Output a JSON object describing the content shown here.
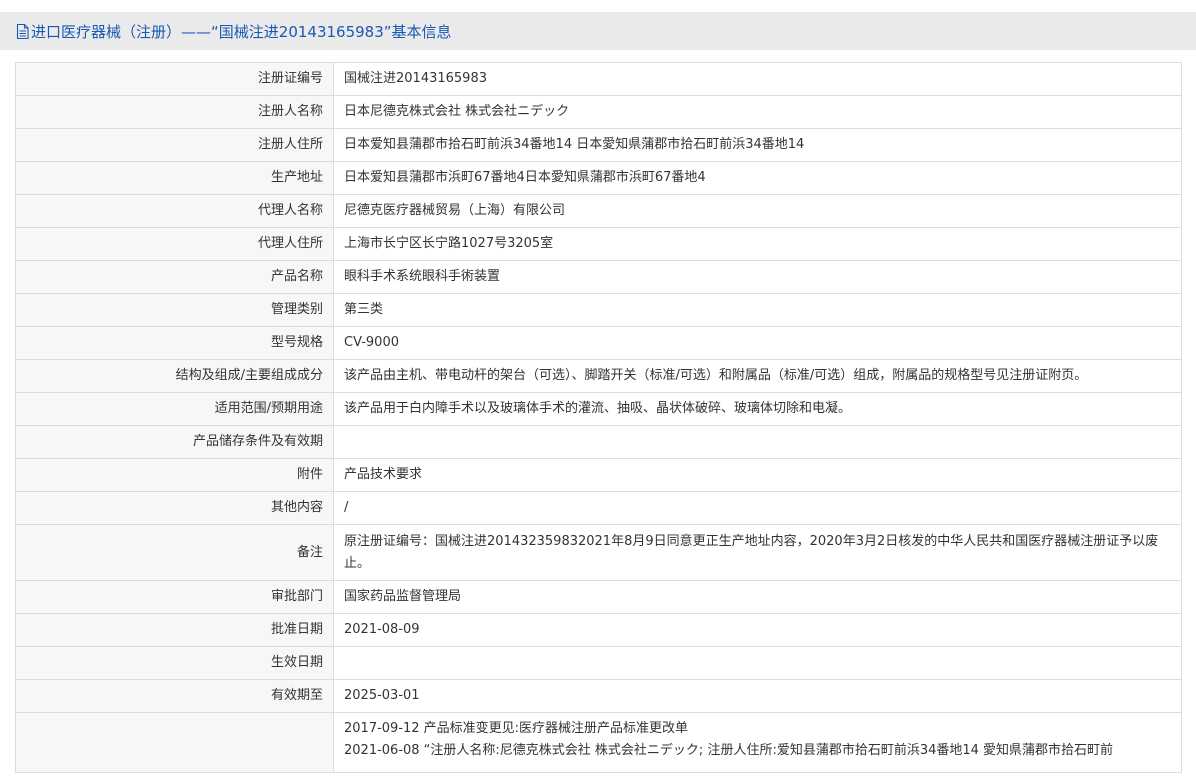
{
  "page": {
    "title": "进口医疗器械（注册）——“国械注进20143165983”基本信息",
    "title_color": "#1a58b4"
  },
  "rows": [
    {
      "label": "注册证编号",
      "value": "国械注进20143165983"
    },
    {
      "label": "注册人名称",
      "value": "日本尼德克株式会社 株式会社ニデック"
    },
    {
      "label": "注册人住所",
      "value": "日本爱知县蒲郡市拾石町前浜34番地14 日本愛知県蒲郡市拾石町前浜34番地14"
    },
    {
      "label": "生产地址",
      "value": "日本爱知县蒲郡市浜町67番地4日本愛知県蒲郡市浜町67番地4"
    },
    {
      "label": "代理人名称",
      "value": "尼德克医疗器械贸易（上海）有限公司"
    },
    {
      "label": "代理人住所",
      "value": "上海市长宁区长宁路1027号3205室"
    },
    {
      "label": "产品名称",
      "value": "眼科手术系统眼科手術装置"
    },
    {
      "label": "管理类别",
      "value": "第三类"
    },
    {
      "label": "型号规格",
      "value": "CV-9000"
    },
    {
      "label": "结构及组成/主要组成成分",
      "value": "该产品由主机、带电动杆的架台（可选）、脚踏开关（标准/可选）和附属品（标准/可选）组成，附属品的规格型号见注册证附页。"
    },
    {
      "label": "适用范围/预期用途",
      "value": "该产品用于白内障手术以及玻璃体手术的灌流、抽吸、晶状体破碎、玻璃体切除和电凝。"
    },
    {
      "label": "产品储存条件及有效期",
      "value": ""
    },
    {
      "label": "附件",
      "value": "产品技术要求"
    },
    {
      "label": "其他内容",
      "value": "/"
    },
    {
      "label": "备注",
      "value": "原注册证编号：国械注进201432359832021年8月9日同意更正生产地址内容，2020年3月2日核发的中华人民共和国医疗器械注册证予以废止。"
    },
    {
      "label": "审批部门",
      "value": "国家药品监督管理局"
    },
    {
      "label": "批准日期",
      "value": "2021-08-09"
    },
    {
      "label": "生效日期",
      "value": ""
    },
    {
      "label": "有效期至",
      "value": "2025-03-01"
    }
  ],
  "changes": [
    "2017-09-12 产品标准变更见:医疗器械注册产品标准更改单",
    "2021-06-08 “注册人名称:尼德克株式会社 株式会社ニデック; 注册人住所:爱知县蒲郡市拾石町前浜34番地14 愛知県蒲郡市拾石町前"
  ]
}
